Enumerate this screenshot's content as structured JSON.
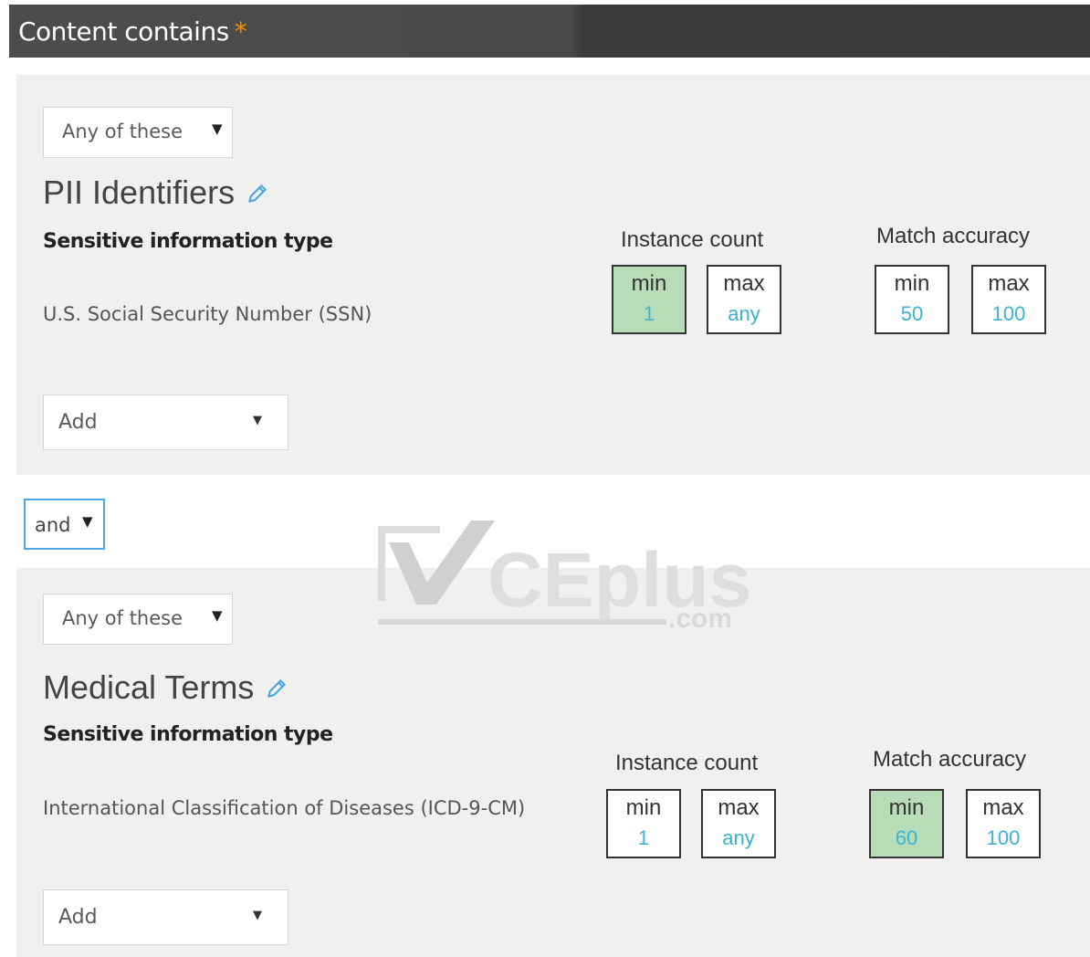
{
  "header": {
    "title": "Content contains",
    "required_marker": "*"
  },
  "operator": {
    "label": "and",
    "arrow": "▼"
  },
  "groups": [
    {
      "match_select": {
        "label": "Any of these",
        "arrow": "▼"
      },
      "title": "PII Identifiers",
      "column_header": "Sensitive information type",
      "info_type": "U.S. Social Security Number (SSN)",
      "instance_count": {
        "label": "Instance count",
        "min_label": "min",
        "min": "1",
        "max_label": "max",
        "max": "any"
      },
      "match_accuracy": {
        "label": "Match accuracy",
        "min_label": "min",
        "min": "50",
        "max_label": "max",
        "max": "100"
      },
      "add_select": {
        "label": "Add",
        "arrow": "▼"
      }
    },
    {
      "match_select": {
        "label": "Any of these",
        "arrow": "▼"
      },
      "title": "Medical Terms",
      "column_header": "Sensitive information type",
      "info_type": "International Classification of Diseases (ICD-9-CM)",
      "instance_count": {
        "label": "Instance count",
        "min_label": "min",
        "min": "1",
        "max_label": "max",
        "max": "any"
      },
      "match_accuracy": {
        "label": "Match accuracy",
        "min_label": "min",
        "min": "60",
        "max_label": "max",
        "max": "100"
      },
      "add_select": {
        "label": "Add",
        "arrow": "▼"
      }
    }
  ],
  "watermark": {
    "brand": "CEplus",
    "suffix": ".com"
  },
  "colors": {
    "header_bg": "#4a4a4a",
    "required_star": "#ff8c00",
    "panel_bg": "#f0f0f0",
    "value_text": "#3ab3d4",
    "highlight_box": "#b8dcb8",
    "focus_border": "#4da6e0"
  },
  "icons": {
    "edit": "pencil-icon",
    "dropdown": "chevron-down-icon",
    "watermark_mark": "checkmark-icon"
  }
}
